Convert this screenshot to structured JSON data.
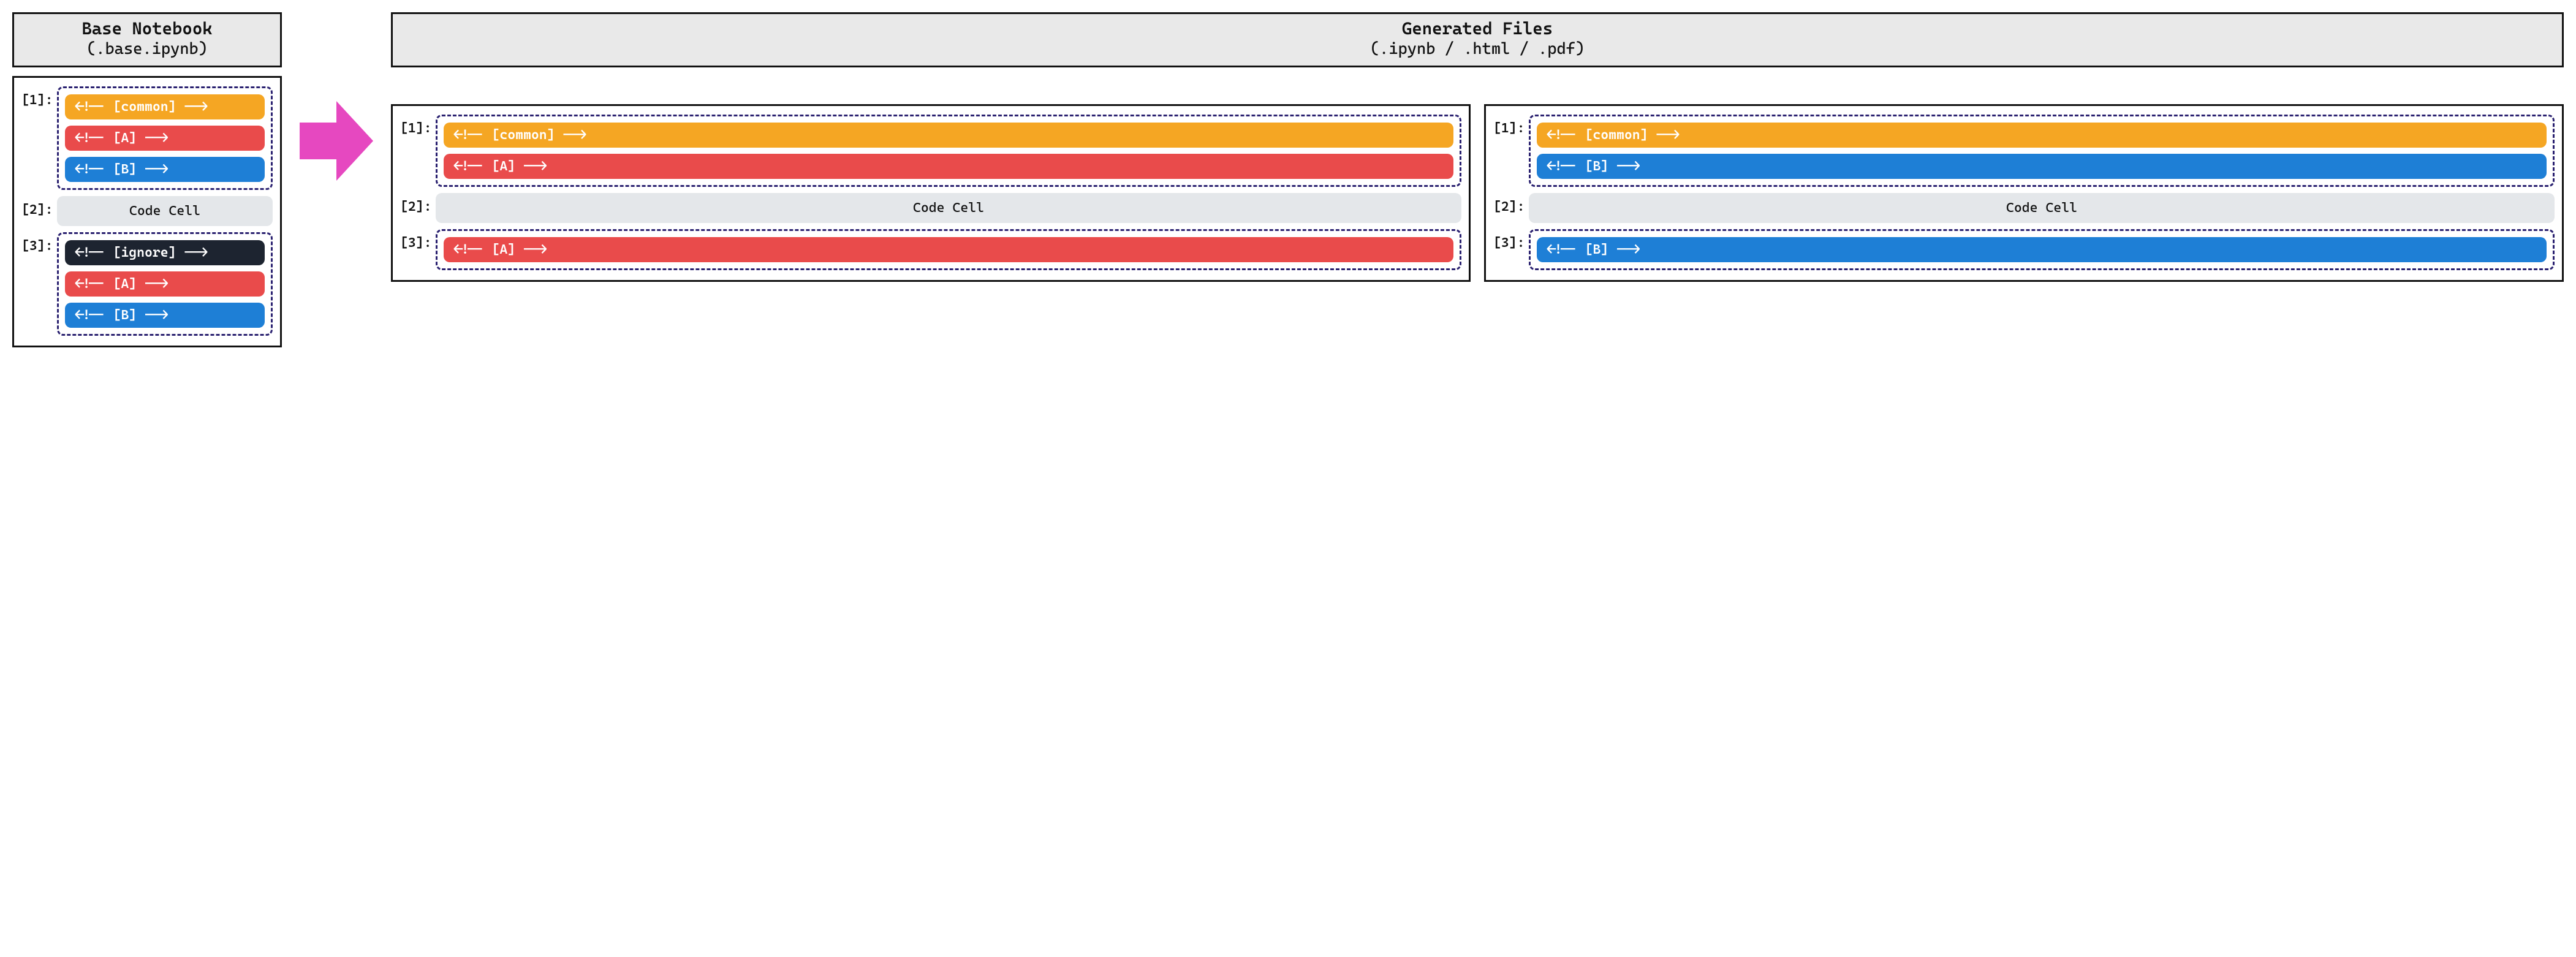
{
  "colors": {
    "common": "#f5a623",
    "a": "#e94b4b",
    "b": "#1e7fd6",
    "ignore": "#1d2430",
    "code_bg": "#e4e7ea",
    "dash_border": "#2a2170",
    "arrow": "#e648c0",
    "header_bg": "#e9e9e9"
  },
  "base": {
    "title": "Base Notebook",
    "subtitle": "(.base.ipynb)",
    "cells": {
      "c1": {
        "idx": "[1]:",
        "common": "<!-- [common] -->",
        "a": "<!-- [A] -->",
        "b": "<!-- [B] -->"
      },
      "c2": {
        "idx": "[2]:",
        "label": "Code Cell"
      },
      "c3": {
        "idx": "[3]:",
        "ignore": "<!-- [ignore] -->",
        "a": "<!-- [A] -->",
        "b": "<!-- [B] -->"
      }
    }
  },
  "generated": {
    "title": "Generated Files",
    "subtitle": "(.ipynb / .html / .pdf)",
    "left": {
      "c1": {
        "idx": "[1]:",
        "common": "<!-- [common] -->",
        "a": "<!-- [A] -->"
      },
      "c2": {
        "idx": "[2]:",
        "label": "Code Cell"
      },
      "c3": {
        "idx": "[3]:",
        "a": "<!-- [A] -->"
      }
    },
    "right": {
      "c1": {
        "idx": "[1]:",
        "common": "<!-- [common] -->",
        "b": "<!-- [B] -->"
      },
      "c2": {
        "idx": "[2]:",
        "label": "Code Cell"
      },
      "c3": {
        "idx": "[3]:",
        "b": "<!-- [B] -->"
      }
    }
  }
}
